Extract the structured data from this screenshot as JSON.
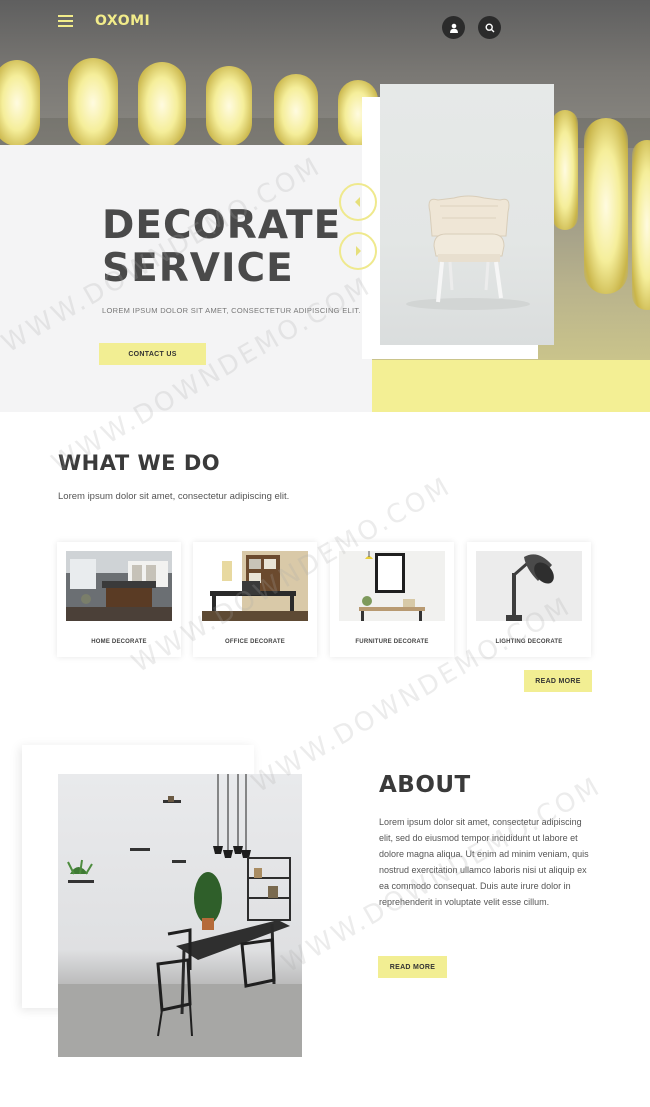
{
  "header": {
    "brand": "OXOMI",
    "menu_icon": "hamburger-menu-icon",
    "user_icon": "user-icon",
    "search_icon": "search-icon"
  },
  "hero": {
    "title_line1": "DECORATE",
    "title_line2": "SERVICE",
    "subtitle": "LOREM IPSUM DOLOR SIT AMET, CONSECTETUR ADIPISCING ELIT.",
    "cta_label": "CONTACT US",
    "prev_icon": "chevron-left-icon",
    "next_icon": "chevron-right-icon"
  },
  "services": {
    "title": "WHAT WE DO",
    "description": "Lorem ipsum dolor sit amet, consectetur adipiscing elit.",
    "items": [
      {
        "label": "HOME DECORATE"
      },
      {
        "label": "OFFICE DECORATE"
      },
      {
        "label": "FURNITURE DECORATE"
      },
      {
        "label": "LIGHTING DECORATE"
      }
    ],
    "read_more_label": "READ MORE"
  },
  "about": {
    "title": "ABOUT",
    "body": "Lorem ipsum dolor sit amet, consectetur adipiscing elit, sed do eiusmod tempor incididunt ut labore et dolore magna aliqua. Ut enim ad minim veniam, quis nostrud exercitation ullamco laboris nisi ut aliquip ex ea commodo consequat. Duis aute irure dolor in reprehenderit in voluptate velit esse cillum.",
    "read_more_label": "READ MORE"
  },
  "watermark": "WWW.DOWNDEMO.COM",
  "colors": {
    "accent_yellow": "#f2ee93",
    "heading": "#3a3a3a",
    "dark_button": "#2b2b2b"
  }
}
